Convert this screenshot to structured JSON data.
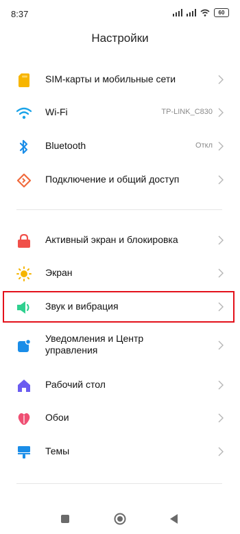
{
  "status_bar": {
    "time": "8:37",
    "battery": "60"
  },
  "header": {
    "title": "Настройки"
  },
  "section1": [
    {
      "label": "SIM-карты и мобильные сети",
      "value": "",
      "icon": "sim-card-icon"
    },
    {
      "label": "Wi-Fi",
      "value": "TP-LINK_C830",
      "icon": "wifi-icon"
    },
    {
      "label": "Bluetooth",
      "value": "Откл",
      "icon": "bluetooth-icon"
    },
    {
      "label": "Подключение и общий доступ",
      "value": "",
      "icon": "connection-sharing-icon"
    }
  ],
  "section2": [
    {
      "label": "Активный экран и блокировка",
      "icon": "lock-icon"
    },
    {
      "label": "Экран",
      "icon": "sun-icon"
    },
    {
      "label": "Звук и вибрация",
      "icon": "speaker-icon",
      "highlighted": true
    },
    {
      "label": "Уведомления и Центр управления",
      "icon": "notification-icon"
    },
    {
      "label": "Рабочий стол",
      "icon": "home-screen-icon"
    },
    {
      "label": "Обои",
      "icon": "wallpaper-icon"
    },
    {
      "label": "Темы",
      "icon": "themes-icon"
    }
  ],
  "colors": {
    "sim": "#f7b500",
    "wifi": "#1aa3e8",
    "bluetooth": "#1a8de8",
    "connection": "#f06a3c",
    "lock": "#f0504a",
    "sun": "#f5b400",
    "sound": "#2fd08f",
    "notification": "#1a8de8",
    "home": "#6b5cf0",
    "wallpaper": "#ef4f73",
    "themes": "#1a8de8",
    "highlight": "#e3101a"
  }
}
